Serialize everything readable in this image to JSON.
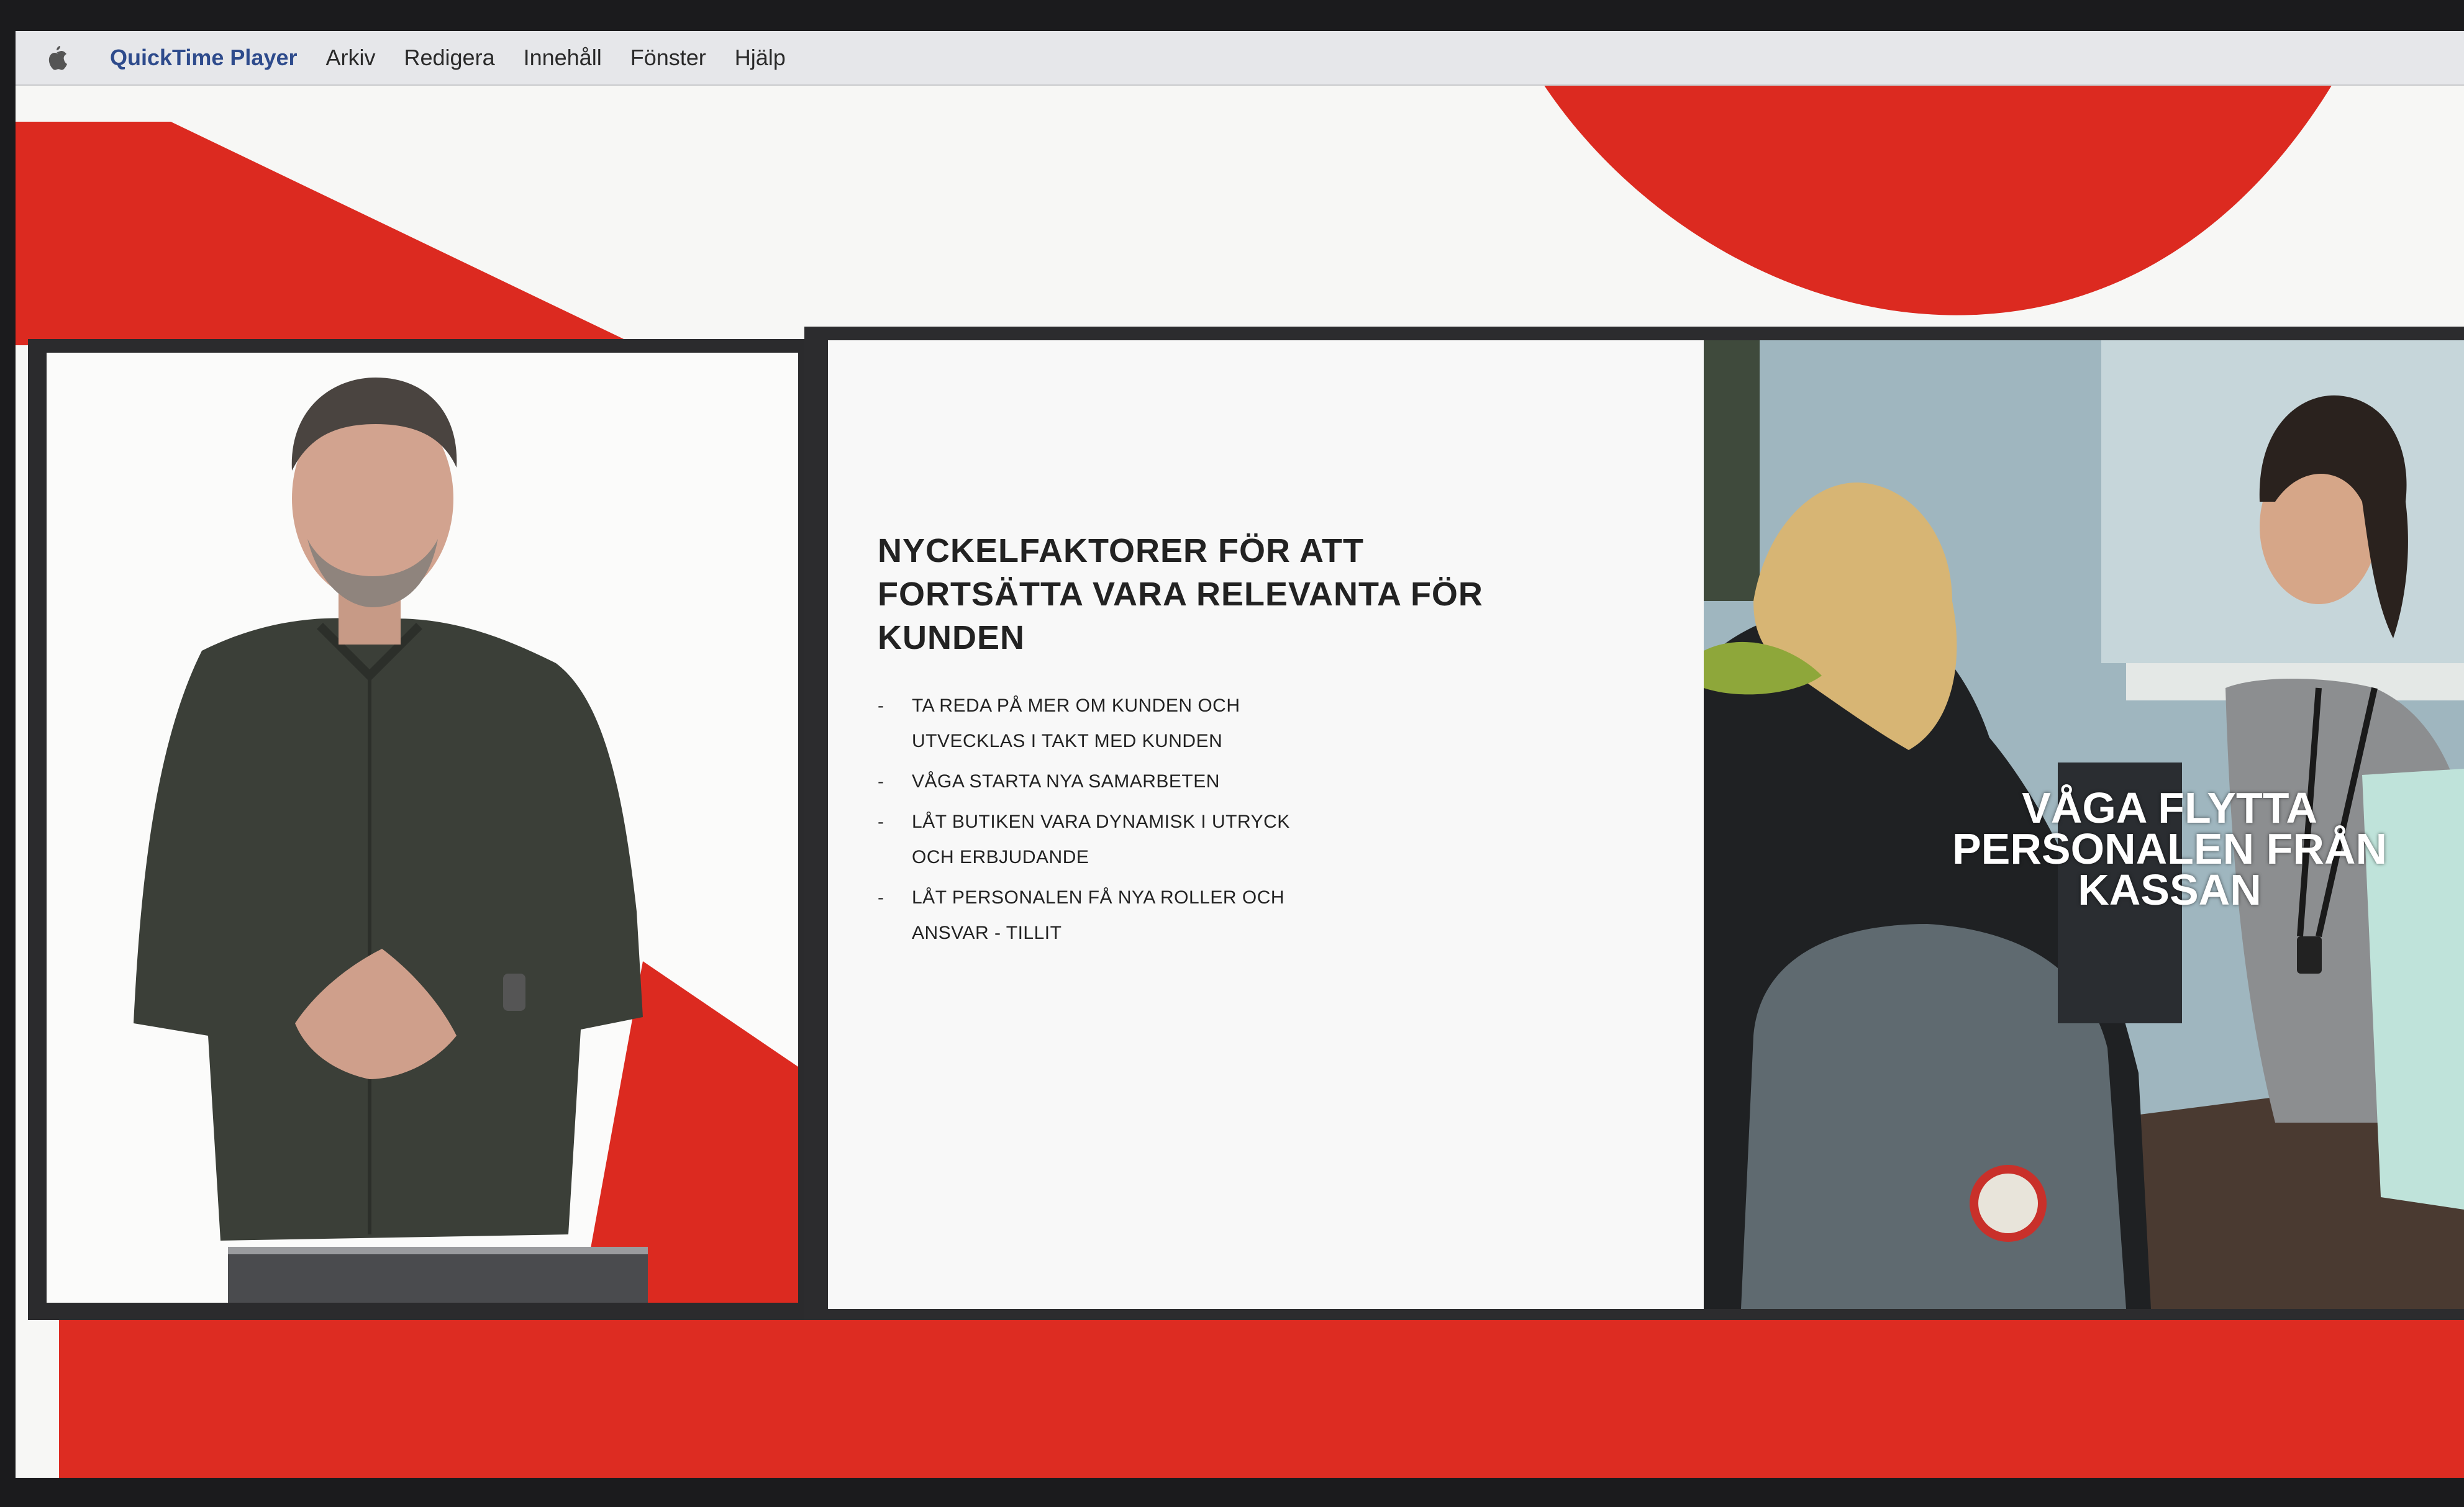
{
  "menubar": {
    "apple_icon": "apple-icon",
    "app_name": "QuickTime Player",
    "items": [
      "Arkiv",
      "Redigera",
      "Innehåll",
      "Fönster",
      "Hjälp"
    ]
  },
  "slide": {
    "title": "NYCKELFAKTORER FÖR ATT FORTSÄTTA VARA RELEVANTA FÖR KUNDEN",
    "bullets": [
      {
        "dash": "-",
        "text": "TA REDA PÅ MER OM KUNDEN OCH UTVECKLAS I TAKT MED KUNDEN"
      },
      {
        "dash": "-",
        "text": "VÅGA STARTA NYA SAMARBETEN"
      },
      {
        "dash": "-",
        "text": "LÅT BUTIKEN VARA DYNAMISK I UTRYCK OCH ERBJUDANDE"
      },
      {
        "dash": "-",
        "text": "LÅT PERSONALEN FÅ NYA ROLLER OCH ANSVAR - TILLIT"
      }
    ],
    "photo_caption": "VÅGA FLYTTA PERSONALEN FRÅN KASSAN"
  },
  "colors": {
    "brand_red": "#dd2c22",
    "menubar": "#e6e7ea",
    "frame_dark": "#2b2b2d"
  }
}
